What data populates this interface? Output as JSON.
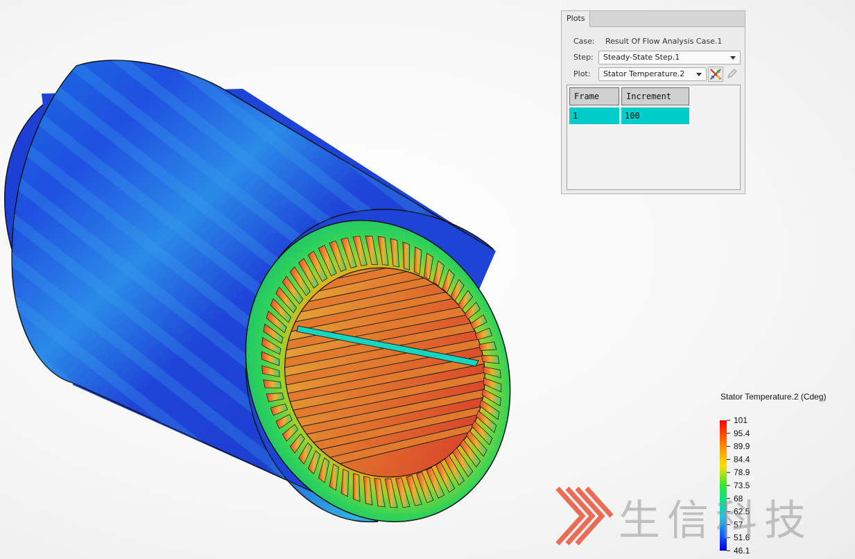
{
  "plots_panel": {
    "tab_label": "Plots",
    "case_label": "Case:",
    "case_value": "Result Of Flow Analysis Case.1",
    "step_label": "Step:",
    "step_value": "Steady-State Step.1",
    "plot_label": "Plot:",
    "plot_value": "Stator Temperature.2",
    "table": {
      "headers": [
        "Frame",
        "Increment"
      ],
      "rows": [
        [
          "1",
          "100"
        ]
      ]
    },
    "selected_row_color": "#00cdc9"
  },
  "legend": {
    "title": "Stator Temperature.2 (Cdeg)",
    "ticks": [
      "101",
      "95.4",
      "89.9",
      "84.4",
      "78.9",
      "73.5",
      "68",
      "62.5",
      "57",
      "51.6",
      "46.1"
    ]
  },
  "watermark": {
    "text": "生信科技",
    "accent_color": "#e8553c"
  },
  "icons": {
    "plot_tool": "scatter-plot-icon",
    "edit": "pencil-icon"
  }
}
